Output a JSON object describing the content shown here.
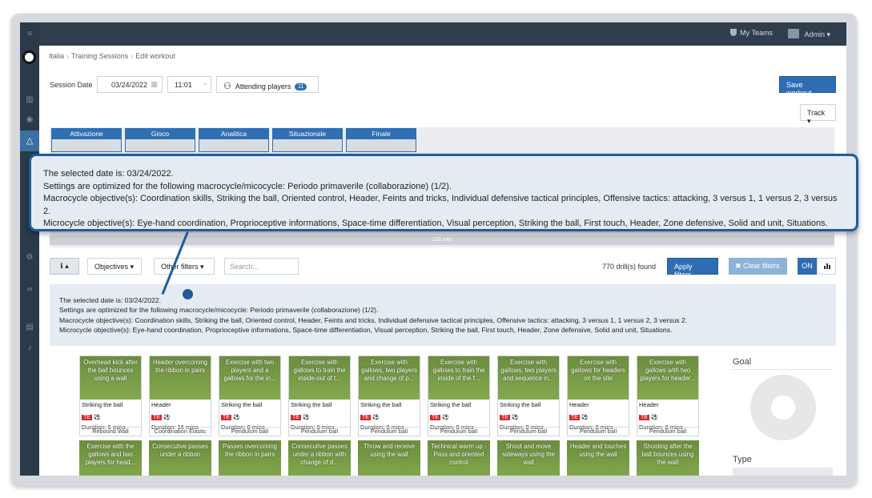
{
  "topbar": {
    "my_teams": "My Teams",
    "admin": "Admin ▾"
  },
  "breadcrumb": [
    "Italia",
    "Training Sessions",
    "Edit workout"
  ],
  "session": {
    "date_label": "Session Date",
    "date": "03/24/2022",
    "time": "11:01",
    "attending_label": "Attending players",
    "attending_count": "11",
    "save_label": "Save workout",
    "track_label": "Track ▾"
  },
  "phases": [
    "Attivazione",
    "Gioco",
    "Analitica",
    "Situazionale",
    "Finale"
  ],
  "timeline_label": "120 min",
  "filters": {
    "objectives_label": "Objectives",
    "other_filters_label": "Other filters",
    "search_placeholder": "Search...",
    "found_text": "770 drill(s) found",
    "apply_label": "Apply filters",
    "clear_label": "✖ Clear filters",
    "on_label": "ON"
  },
  "info": {
    "line1": "The selected date is: 03/24/2022.",
    "line2": "Settings are optimized for the following macrocycle/micocycle: Periodo primaverile (collaborazione) (1/2).",
    "line3": "Macrocycle objective(s): Coordination skills, Striking the ball, Oriented control, Header, Feints and tricks, Individual defensive tactical principles, Offensive tactics: attacking, 3 versus 1, 1 versus 2, 3 versus 2.",
    "line4": "Microcycle objective(s): Eye-hand coordination, Proprioceptive informations, Space-time differentiation, Visual perception, Striking the ball, First touch, Header, Zone defensive, Solid and unit, Situations."
  },
  "drills_row1": [
    {
      "title": "Overhead kick after the ball bounces using a wall",
      "category": "Striking the ball",
      "te": "TE",
      "ball": "⚽",
      "duration": "Duration: 6 mins",
      "type": "Rebound Wall"
    },
    {
      "title": "Header overcoming the ribbon in pairs",
      "category": "Header",
      "te": "TE",
      "ball": "⚽",
      "duration": "Duration: 16 mins",
      "type": "Coordination Elastic"
    },
    {
      "title": "Exercise with two players and a gallows for the in...",
      "category": "Striking the ball",
      "te": "TE",
      "ball": "⚽",
      "duration": "Duration: 8 mins",
      "type": "Pendulum ball"
    },
    {
      "title": "Exercise with gallows to train the inside-out of t...",
      "category": "Striking the ball",
      "te": "TE",
      "ball": "⚽",
      "duration": "Duration: 8 mins",
      "type": "Pendulum ball"
    },
    {
      "title": "Exercise with gallows, two players and change of p...",
      "category": "Striking the ball",
      "te": "TE",
      "ball": "⚽",
      "duration": "Duration: 8 mins",
      "type": "Pendulum ball"
    },
    {
      "title": "Exercise with gallows to train the inside of the f...",
      "category": "Striking the ball",
      "te": "TE",
      "ball": "⚽",
      "duration": "Duration: 8 mins",
      "type": "Pendulum ball"
    },
    {
      "title": "Exercise with gallows, two players and sequence in...",
      "category": "Striking the ball",
      "te": "TE",
      "ball": "⚽",
      "duration": "Duration: 8 mins",
      "type": "Pendulum ball"
    },
    {
      "title": "Exercise with gallows for headers on the site",
      "category": "Header",
      "te": "TE",
      "ball": "⚽",
      "duration": "Duration: 8 mins",
      "type": "Pendulum ball"
    },
    {
      "title": "Exercise with gallows with two players for header...",
      "category": "Header",
      "te": "TE",
      "ball": "⚽",
      "duration": "Duration: 8 mins",
      "type": "Pendulum ball"
    }
  ],
  "drills_row2": [
    {
      "title": "Exercise with the gallows and two players for head..."
    },
    {
      "title": "Consecutive passes under a ribbon"
    },
    {
      "title": "Passes overcoming the ribbon in pairs"
    },
    {
      "title": "Consecutive passes under a ribbon with change of d..."
    },
    {
      "title": "Throw and receive using the wall"
    },
    {
      "title": "Technical warm up - Pass and oriented control"
    },
    {
      "title": "Shoot and move sideways using the wall"
    },
    {
      "title": "Header and touches using the wall"
    },
    {
      "title": "Shooting after the ball bounces using the wall"
    }
  ],
  "side_panel": {
    "goal_title": "Goal",
    "type_title": "Type"
  }
}
